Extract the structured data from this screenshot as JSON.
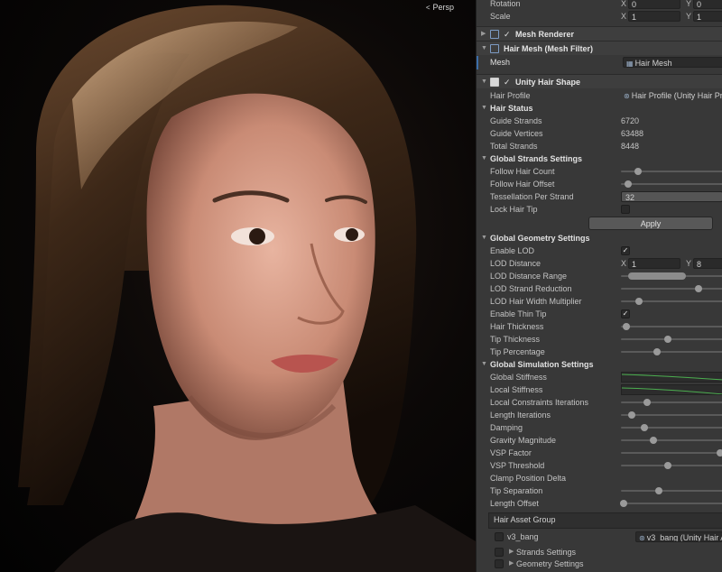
{
  "scene": {
    "view_mode": "Persp",
    "persp_icon": "axis-gizmo-icon",
    "subject_description": "Rendered 3D portrait of a woman with shoulder-length brown hair"
  },
  "transform": {
    "rotation_label": "Rotation",
    "rotation_x": "0",
    "rotation_y": "0",
    "scale_label": "Scale",
    "scale_x": "1",
    "scale_y": "1"
  },
  "components": {
    "mesh_renderer": "Mesh Renderer",
    "mesh_filter": "Hair Mesh (Mesh Filter)",
    "mesh_label": "Mesh",
    "mesh_value": "Hair Mesh",
    "hair_shape": "Unity Hair Shape"
  },
  "hair_profile": {
    "label": "Hair Profile",
    "value": "Hair Profile (Unity Hair Pro"
  },
  "hair_status": {
    "title": "Hair Status",
    "guide_strands_label": "Guide Strands",
    "guide_strands": "6720",
    "guide_vertices_label": "Guide Vertices",
    "guide_vertices": "63488",
    "total_strands_label": "Total Strands",
    "total_strands": "8448"
  },
  "strands_settings": {
    "title": "Global Strands Settings",
    "follow_count_label": "Follow Hair Count",
    "follow_offset_label": "Follow Hair Offset",
    "tessellation_label": "Tessellation Per Strand",
    "tessellation": "32",
    "lock_tip_label": "Lock Hair Tip",
    "apply_label": "Apply"
  },
  "geometry_settings": {
    "title": "Global Geometry Settings",
    "enable_lod_label": "Enable LOD",
    "lod_distance_label": "LOD Distance",
    "lod_distance_x": "1",
    "lod_distance_y": "8",
    "lod_range_label": "LOD Distance Range",
    "lod_reduction_label": "LOD Strand Reduction",
    "lod_width_label": "LOD Hair Width Multiplier",
    "thin_tip_label": "Enable Thin Tip",
    "thickness_label": "Hair Thickness",
    "tip_thickness_label": "Tip Thickness",
    "tip_percentage_label": "Tip Percentage"
  },
  "simulation_settings": {
    "title": "Global Simulation Settings",
    "global_stiffness_label": "Global Stiffness",
    "local_stiffness_label": "Local Stiffness",
    "local_constraints_label": "Local Constraints Iterations",
    "length_iterations_label": "Length Iterations",
    "damping_label": "Damping",
    "gravity_label": "Gravity Magnitude",
    "vsp_factor_label": "VSP Factor",
    "vsp_threshold_label": "VSP Threshold",
    "clamp_label": "Clamp Position Delta",
    "tip_separation_label": "Tip Separation",
    "length_offset_label": "Length Offset"
  },
  "asset_group": {
    "title": "Hair Asset Group",
    "asset_name": "v3_bang",
    "asset_value": "v3_bang (Unity Hair A",
    "strands_settings_label": "Strands Settings",
    "geometry_settings_label": "Geometry Settings"
  },
  "slider_levels": {
    "follow_count": 0.17,
    "follow_offset": 0.07,
    "lod_reduction": 0.76,
    "lod_width": 0.18,
    "thickness": 0.05,
    "tip_thickness": 0.46,
    "tip_percentage": 0.35,
    "local_constraints": 0.26,
    "length_iterations": 0.11,
    "damping": 0.23,
    "gravity": 0.32,
    "vsp_factor": 0.97,
    "vsp_threshold": 0.46,
    "tip_separation": 0.37,
    "length_offset": 0.03
  },
  "colors": {
    "inspector_bg": "#383838",
    "curve_green": "#4caf50",
    "selected_blue": "#3d6ea8"
  }
}
